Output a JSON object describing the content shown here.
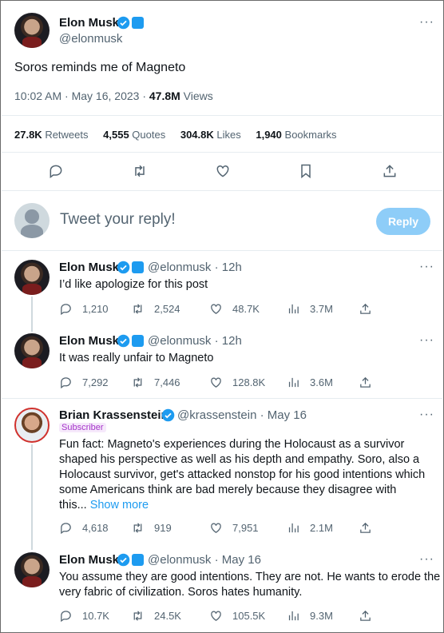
{
  "main_tweet": {
    "author_name": "Elon Musk",
    "author_handle": "@elonmusk",
    "text": "Soros reminds me of Magneto",
    "time": "10:02 AM · May 16, 2023 · ",
    "views_count": "47.8M",
    "views_label": " Views",
    "stats": {
      "retweets_num": "27.8K",
      "retweets_lbl": " Retweets",
      "quotes_num": "4,555",
      "quotes_lbl": " Quotes",
      "likes_num": "304.8K",
      "likes_lbl": " Likes",
      "bookmarks_num": "1,940",
      "bookmarks_lbl": " Bookmarks"
    }
  },
  "reply_box": {
    "placeholder": "Tweet your reply!",
    "button_label": "Reply"
  },
  "replies": [
    {
      "name": "Elon Musk",
      "handle": "@elonmusk · 12h",
      "text": "I’d like apologize for this post",
      "replies": "1,210",
      "retweets": "2,524",
      "likes": "48.7K",
      "views": "3.7M"
    },
    {
      "name": "Elon Musk",
      "handle": "@elonmusk · 12h",
      "text": "It was really unfair to Magneto",
      "replies": "7,292",
      "retweets": "7,446",
      "likes": "128.8K",
      "views": "3.6M"
    },
    {
      "name": "Brian Krassenstein",
      "handle": "@krassenstein · May 16",
      "badge": "Subscriber",
      "lines": [
        "Fun fact:  Magneto's experiences during the Holocaust as a survivor",
        "shaped his perspective as well as his depth and empathy.  Soro, also a",
        "Holocaust survivor, get's attacked nonstop for his good intentions which",
        "some Americans think are bad merely because they disagree with",
        "this... "
      ],
      "show_more": "Show more",
      "replies": "4,618",
      "retweets": "919",
      "likes": "7,951",
      "views": "2.1M"
    },
    {
      "name": "Elon Musk",
      "handle": "@elonmusk · May 16",
      "lines": [
        "You assume they are good intentions. They are not. He wants to erode the",
        "very fabric of civilization. Soros hates humanity."
      ],
      "replies": "10.7K",
      "retweets": "24.5K",
      "likes": "105.5K",
      "views": "9.3M"
    }
  ],
  "icons": {
    "verified": "verified-badge-icon",
    "affiliate": "blue-square-icon",
    "more": "more-icon",
    "reply": "reply-icon",
    "retweet": "retweet-icon",
    "like": "heart-icon",
    "bookmark": "bookmark-icon",
    "share": "share-icon",
    "views": "views-icon"
  },
  "colors": {
    "accent": "#1d9bf0",
    "reply_button": "#8ecdf8",
    "subscriber": "#a535c9"
  }
}
